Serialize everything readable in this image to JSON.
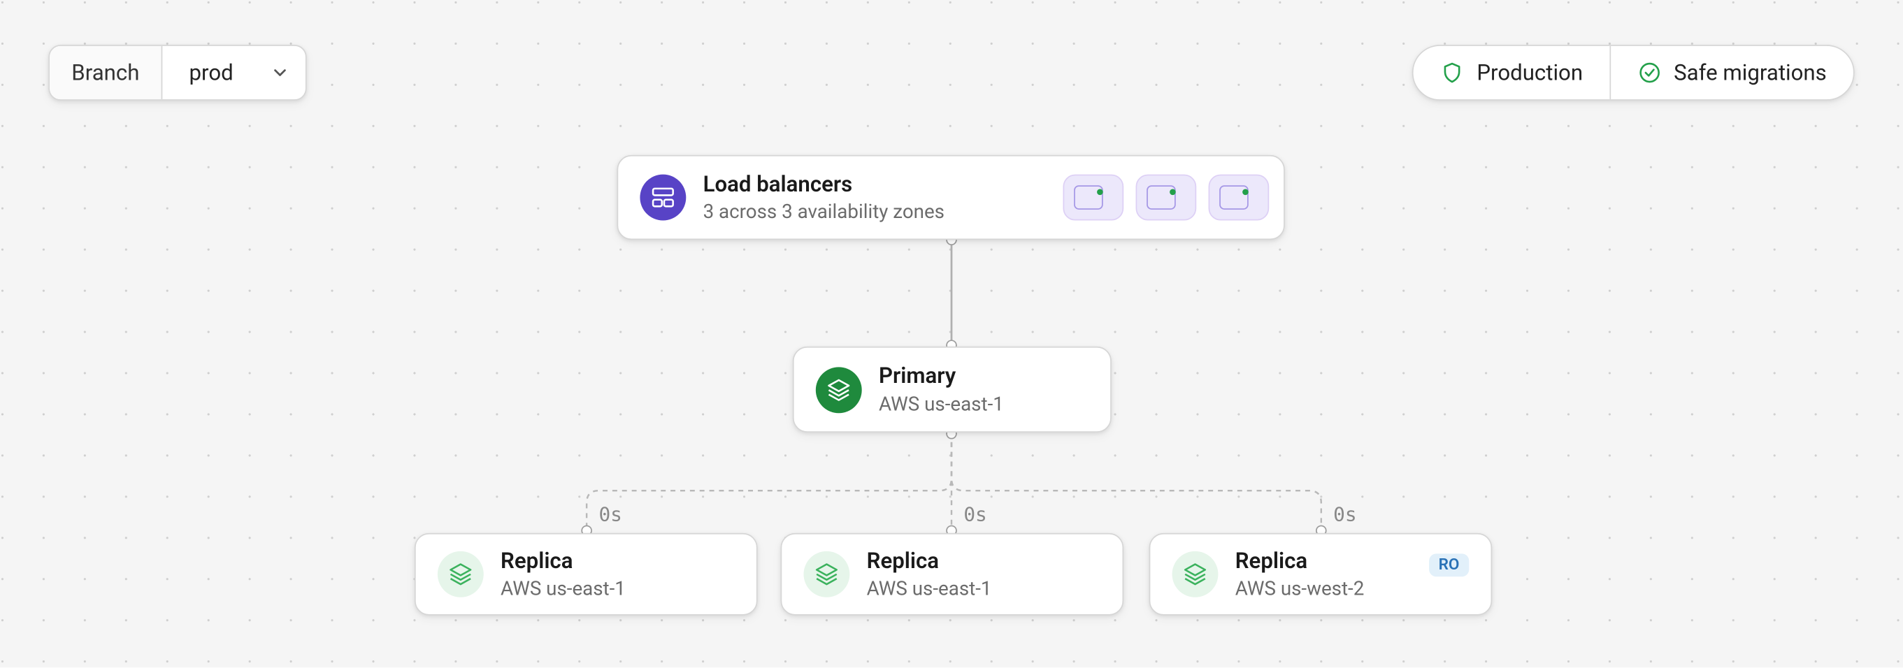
{
  "branch_selector": {
    "label": "Branch",
    "value": "prod"
  },
  "pills": {
    "production": "Production",
    "safe_migrations": "Safe migrations"
  },
  "load_balancers": {
    "title": "Load balancers",
    "subtitle": "3 across 3 availability zones",
    "zone_count": 3
  },
  "primary": {
    "title": "Primary",
    "region": "AWS us-east-1"
  },
  "replicas": [
    {
      "title": "Replica",
      "region": "AWS us-east-1",
      "latency": "0s",
      "badge": null
    },
    {
      "title": "Replica",
      "region": "AWS us-east-1",
      "latency": "0s",
      "badge": null
    },
    {
      "title": "Replica",
      "region": "AWS us-west-2",
      "latency": "0s",
      "badge": "RO"
    }
  ]
}
